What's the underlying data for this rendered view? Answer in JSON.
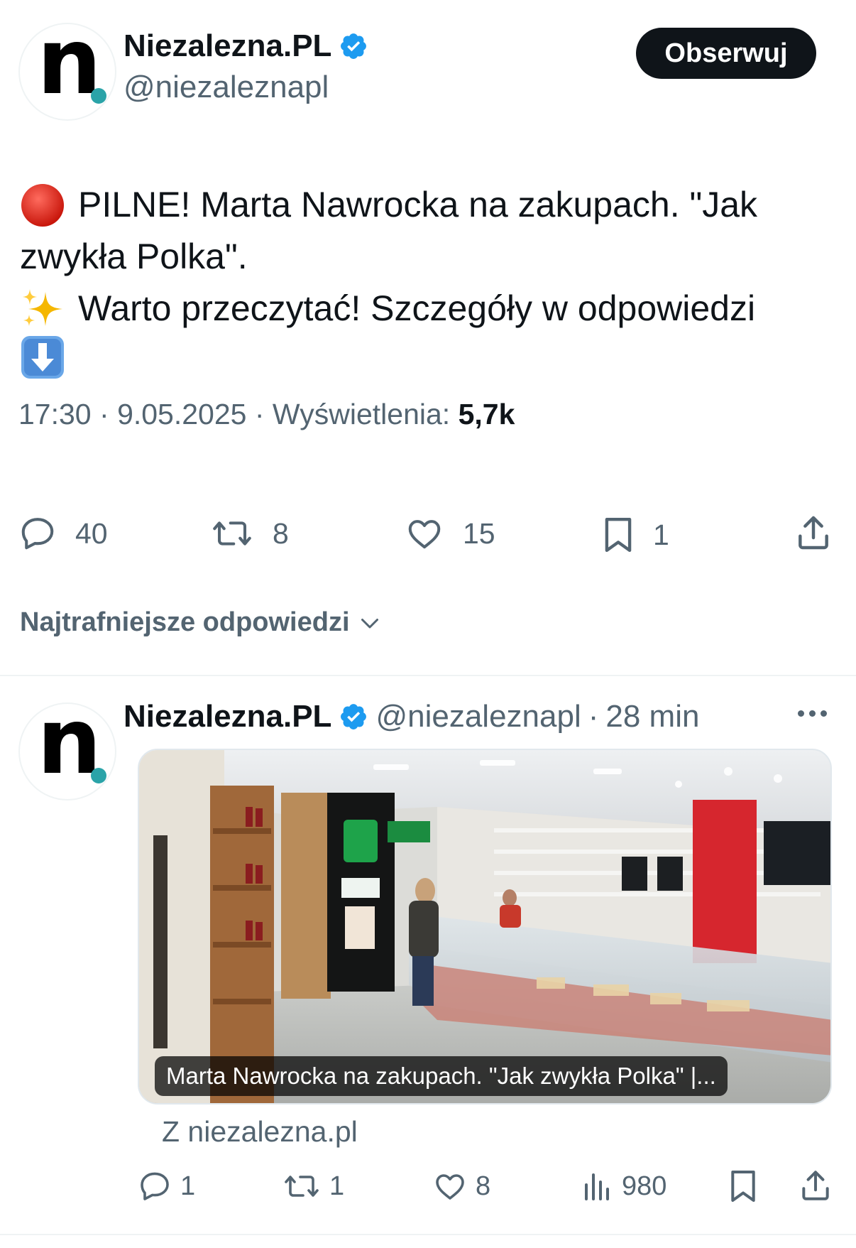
{
  "main_tweet": {
    "author_name": "Niezalezna.PL",
    "author_handle": "@niezaleznapl",
    "follow_label": "Obserwuj",
    "text_line1": "PILNE! Marta Nawrocka na zakupach. \"Jak",
    "text_line2": "zwykła Polka\".",
    "text_line3": "Warto przeczytać! Szczegóły w odpowiedzi",
    "time": "17:30",
    "date": "9.05.2025",
    "views_label": "Wyświetlenia:",
    "views_value": "5,7k",
    "stats": {
      "replies": "40",
      "retweets": "8",
      "likes": "15",
      "bookmarks": "1"
    }
  },
  "replies_sort_label": "Najtrafniejsze odpowiedzi",
  "reply_tweet": {
    "author_name": "Niezalezna.PL",
    "author_handle": "@niezaleznapl",
    "separator": "·",
    "time_ago": "28 min",
    "media_caption": "Marta Nawrocka na zakupach. \"Jak zwykła Polka\" |...",
    "source": "Z niezalezna.pl",
    "stats": {
      "replies": "1",
      "retweets": "1",
      "likes": "8",
      "views": "980"
    }
  },
  "colors": {
    "verified_blue": "#1d9bf0",
    "secondary_text": "#536471",
    "primary_text": "#0f1419",
    "logo_dot": "#2aa3a8"
  }
}
